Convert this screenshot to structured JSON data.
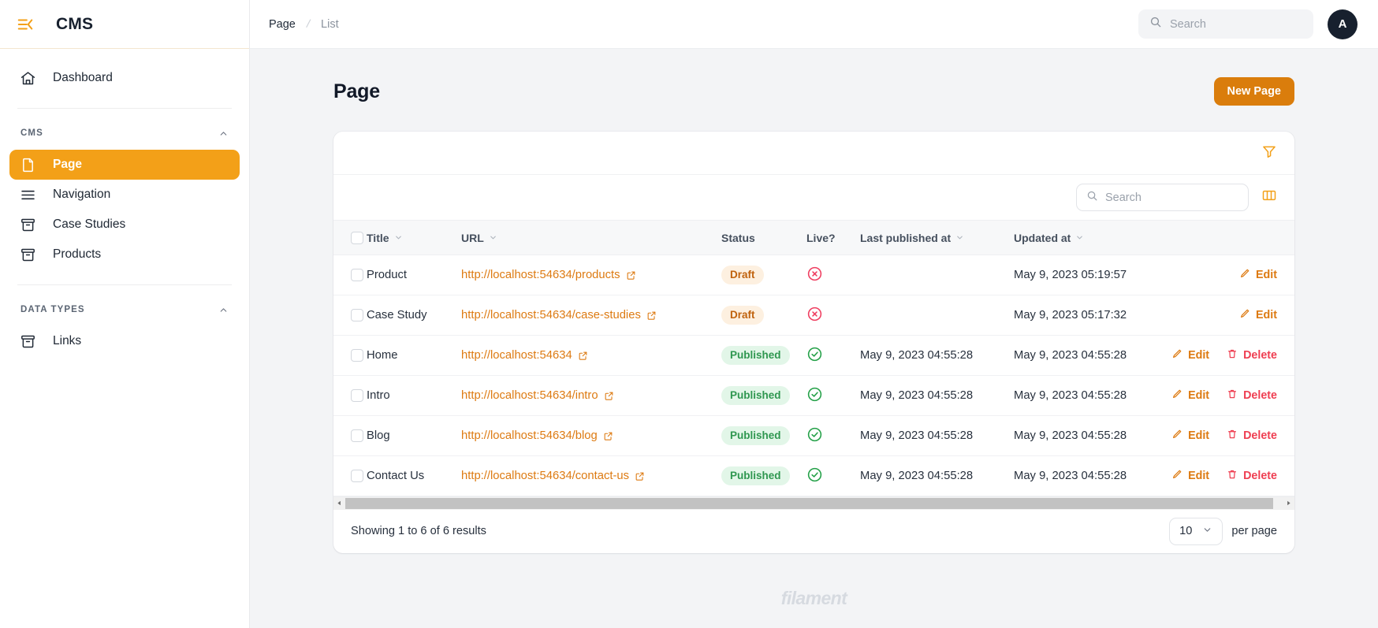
{
  "colors": {
    "brand_orange": "#f3a018",
    "button_orange": "#da7d0c",
    "link_orange": "#dd7a11",
    "danger_red": "#ef3e51",
    "success_green": "#2f9750",
    "sidebar_bg": "#ffffff",
    "page_bg": "#f3f4f6"
  },
  "sidebar": {
    "brand": "CMS",
    "collapse_icon": "collapse-sidebar-icon",
    "dashboard": {
      "label": "Dashboard",
      "icon": "home-icon"
    },
    "groups": [
      {
        "label": "CMS",
        "collapse_icon": "chevron-up-icon",
        "items": [
          {
            "label": "Page",
            "icon": "document-icon",
            "active": true
          },
          {
            "label": "Navigation",
            "icon": "bars-3-icon",
            "active": false
          },
          {
            "label": "Case Studies",
            "icon": "archive-box-icon",
            "active": false
          },
          {
            "label": "Products",
            "icon": "archive-box-icon",
            "active": false
          }
        ]
      },
      {
        "label": "DATA TYPES",
        "collapse_icon": "chevron-up-icon",
        "items": [
          {
            "label": "Links",
            "icon": "archive-box-icon",
            "active": false
          }
        ]
      }
    ]
  },
  "topbar": {
    "breadcrumb": {
      "parent": "Page",
      "separator": "/",
      "current": "List"
    },
    "search": {
      "placeholder": "Search",
      "value": "",
      "icon": "search-icon"
    },
    "avatar": {
      "initial": "A"
    }
  },
  "page": {
    "title": "Page",
    "new_button": "New Page"
  },
  "table": {
    "filter_icon": "funnel-filter-icon",
    "columns_icon": "columns-toggle-icon",
    "search": {
      "placeholder": "Search",
      "value": "",
      "icon": "search-icon"
    },
    "headers": [
      {
        "label": "Title",
        "sortable": true
      },
      {
        "label": "URL",
        "sortable": true
      },
      {
        "label": "Status",
        "sortable": false
      },
      {
        "label": "Live?",
        "sortable": false
      },
      {
        "label": "Last published at",
        "sortable": true
      },
      {
        "label": "Updated at",
        "sortable": true
      }
    ],
    "rows": [
      {
        "title": "Product",
        "url": "http://localhost:54634/products",
        "status": "Draft",
        "status_kind": "draft",
        "live": false,
        "last_published_at": "",
        "updated_at": "May 9, 2023 05:19:57",
        "actions": [
          "Edit"
        ]
      },
      {
        "title": "Case Study",
        "url": "http://localhost:54634/case-studies",
        "status": "Draft",
        "status_kind": "draft",
        "live": false,
        "last_published_at": "",
        "updated_at": "May 9, 2023 05:17:32",
        "actions": [
          "Edit"
        ]
      },
      {
        "title": "Home",
        "url": "http://localhost:54634",
        "status": "Published",
        "status_kind": "published",
        "live": true,
        "last_published_at": "May 9, 2023 04:55:28",
        "updated_at": "May 9, 2023 04:55:28",
        "actions": [
          "Edit",
          "Delete"
        ]
      },
      {
        "title": "Intro",
        "url": "http://localhost:54634/intro",
        "status": "Published",
        "status_kind": "published",
        "live": true,
        "last_published_at": "May 9, 2023 04:55:28",
        "updated_at": "May 9, 2023 04:55:28",
        "actions": [
          "Edit",
          "Delete"
        ]
      },
      {
        "title": "Blog",
        "url": "http://localhost:54634/blog",
        "status": "Published",
        "status_kind": "published",
        "live": true,
        "last_published_at": "May 9, 2023 04:55:28",
        "updated_at": "May 9, 2023 04:55:28",
        "actions": [
          "Edit",
          "Delete"
        ]
      },
      {
        "title": "Contact Us",
        "url": "http://localhost:54634/contact-us",
        "status": "Published",
        "status_kind": "published",
        "live": true,
        "last_published_at": "May 9, 2023 04:55:28",
        "updated_at": "May 9, 2023 04:55:28",
        "actions": [
          "Edit",
          "Delete"
        ]
      }
    ],
    "action_labels": {
      "edit": "Edit",
      "delete": "Delete"
    },
    "footer": {
      "results_text": "Showing 1 to 6 of 6 results",
      "per_page_value": "10",
      "per_page_label": "per page"
    }
  },
  "footer": {
    "logo_text": "filament"
  }
}
